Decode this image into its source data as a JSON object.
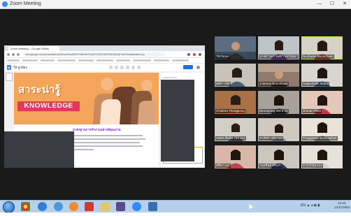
{
  "window": {
    "title": "Zoom Meeting",
    "minimize": "—",
    "maximize": "☐",
    "close": "✕"
  },
  "browser": {
    "tab_title": "Zoom Meeting – Google Slides",
    "url": "docs.google.com/presentation/d/1KtcdXWwNMYPcBHvM7UwkSYL5NTGWTi4WJdk4QHnrA7A/edit#slide=id.p",
    "doc_name": "ให้ ถูกต้อง",
    "present_label": "Present"
  },
  "slide": {
    "thai_title": "สาระน่ารู้",
    "knowledge_label": "KNOWLEDGE",
    "article_heading": "มาตรฐานการทำงานอย่างมีคุณภาพ"
  },
  "gallery": {
    "participants": [
      {
        "name": "ThiTimon"
      },
      {
        "name": "นางสาวเยาวเลขา มลวัณณา"
      },
      {
        "name": "Nucharee Boonchuen"
      },
      {
        "name": "ผุสดา 009"
      },
      {
        "name": "Jutamas Boonkhuan"
      },
      {
        "name": "Angsumalin Mabut"
      },
      {
        "name": "Chatima Thongpong"
      },
      {
        "name": "Bhornpong 009 8 12"
      },
      {
        "name": "Jiranan Pisai"
      },
      {
        "name": "นพดล สินธุ์พานิช 614"
      },
      {
        "name": "อาภัสรา สุขเกษม"
      },
      {
        "name": "Pungpanee Bunkraphan"
      },
      {
        "name": "ศศิธร 016"
      },
      {
        "name": "กมลทิพย์ ศรีแก้ว"
      },
      {
        "name": "จารุวรรณ 613"
      }
    ]
  },
  "taskbar": {
    "tray": "EN ▲ ◂ ◉ ▮",
    "time": "10:15",
    "date": "14/11/2563"
  },
  "colors": {
    "banner": "#f3a55a",
    "knowledge_box": "#e8355f",
    "active_speaker": "#c6e632",
    "taskbar": "#b8d1ea"
  }
}
